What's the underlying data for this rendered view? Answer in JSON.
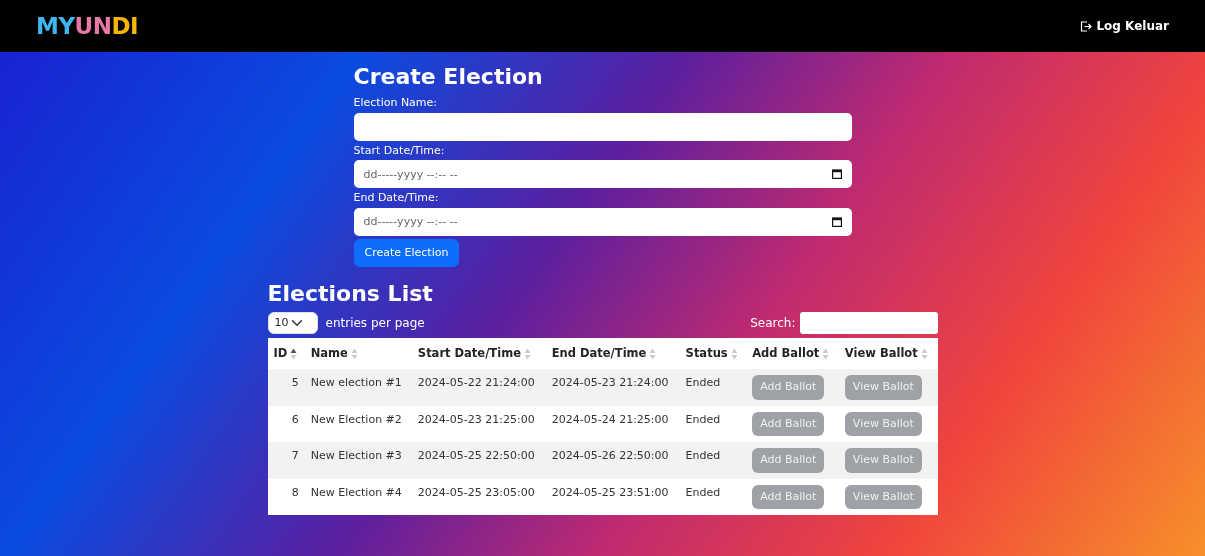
{
  "navbar": {
    "brand_letters": [
      {
        "text": "MY",
        "color": "#3fb6ef"
      },
      {
        "text": "UN",
        "color": "#e879a6"
      },
      {
        "text": "DI",
        "color": "#f7b500"
      }
    ],
    "logout": "Log Keluar"
  },
  "create_form": {
    "title": "Create Election",
    "fields": [
      {
        "label": "Election Name:",
        "kind": "text"
      },
      {
        "label": "Start Date/Time:",
        "kind": "datetime",
        "placeholder": "dd-----yyyy --:-- --"
      },
      {
        "label": "End Date/Time:",
        "kind": "datetime",
        "placeholder": "dd-----yyyy --:-- --"
      }
    ],
    "submit": "Create Election"
  },
  "elections_list": {
    "title": "Elections List",
    "page_size": "10",
    "page_size_label": "entries per page",
    "search_label": "Search:",
    "columns": [
      {
        "label": "ID",
        "sorted": true
      },
      {
        "label": "Name",
        "sorted": false
      },
      {
        "label": "Start Date/Time",
        "sorted": false
      },
      {
        "label": "End Date/Time",
        "sorted": false
      },
      {
        "label": "Status",
        "sorted": false
      },
      {
        "label": "Add Ballot",
        "sorted": false
      },
      {
        "label": "View Ballot",
        "sorted": false
      }
    ],
    "rows": [
      {
        "id": "5",
        "name": "New election #1",
        "start": "2024-05-22 21:24:00",
        "end": "2024-05-23 21:24:00",
        "status": "Ended",
        "add_ballot": "Add Ballot",
        "view_ballot": "View Ballot",
        "disabled": true
      },
      {
        "id": "6",
        "name": "New Election #2",
        "start": "2024-05-23 21:25:00",
        "end": "2024-05-24 21:25:00",
        "status": "Ended",
        "add_ballot": "Add Ballot",
        "view_ballot": "View Ballot",
        "disabled": true
      },
      {
        "id": "7",
        "name": "New Election #3",
        "start": "2024-05-25 22:50:00",
        "end": "2024-05-26 22:50:00",
        "status": "Ended",
        "add_ballot": "Add Ballot",
        "view_ballot": "View Ballot",
        "disabled": true
      },
      {
        "id": "8",
        "name": "New Election #4",
        "start": "2024-05-25 23:05:00",
        "end": "2024-05-25 23:51:00",
        "status": "Ended",
        "add_ballot": "Add Ballot",
        "view_ballot": "View Ballot",
        "disabled": true
      }
    ]
  }
}
